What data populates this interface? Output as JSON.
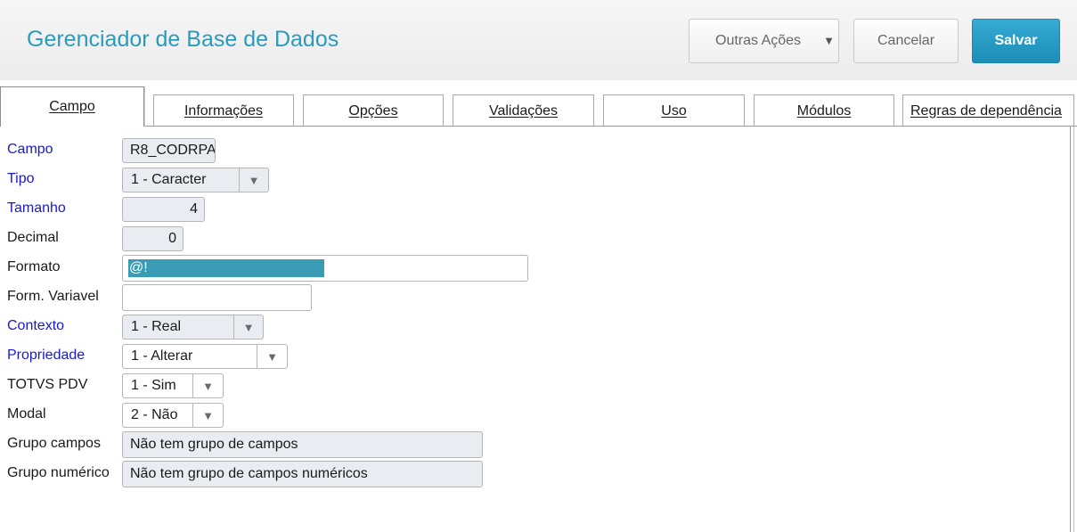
{
  "header": {
    "title": "Gerenciador de Base de Dados",
    "more_actions_label": "Outras Ações",
    "cancel_label": "Cancelar",
    "save_label": "Salvar"
  },
  "tabs": [
    {
      "label": "Campo",
      "active": true
    },
    {
      "label": "Informações",
      "active": false
    },
    {
      "label": "Opções",
      "active": false
    },
    {
      "label": "Validações",
      "active": false
    },
    {
      "label": "Uso",
      "active": false
    },
    {
      "label": "Módulos",
      "active": false
    },
    {
      "label": "Regras de dependência",
      "active": false
    }
  ],
  "form": {
    "campo": {
      "label": "Campo",
      "value": "R8_CODRPA"
    },
    "tipo": {
      "label": "Tipo",
      "value": "1 - Caracter"
    },
    "tamanho": {
      "label": "Tamanho",
      "value": "4"
    },
    "decimal": {
      "label": "Decimal",
      "value": "0"
    },
    "formato": {
      "label": "Formato",
      "value": "@!"
    },
    "form_variavel": {
      "label": "Form. Variavel",
      "value": ""
    },
    "contexto": {
      "label": "Contexto",
      "value": "1 - Real"
    },
    "propriedade": {
      "label": "Propriedade",
      "value": "1 - Alterar"
    },
    "totvs_pdv": {
      "label": "TOTVS PDV",
      "value": "1 - Sim"
    },
    "modal": {
      "label": "Modal",
      "value": "2 - Não"
    },
    "grupo_campos": {
      "label": "Grupo campos",
      "value": "Não tem grupo de campos"
    },
    "grupo_numerico": {
      "label": "Grupo numérico",
      "value": "Não tem grupo de campos numéricos"
    }
  },
  "colors": {
    "accent": "#2a9bbd",
    "save_button": "#1b8db7",
    "required_label": "#1a1acc",
    "selection": "#3a9bb4"
  },
  "icons": {
    "dropdown": "caret-down-icon"
  }
}
